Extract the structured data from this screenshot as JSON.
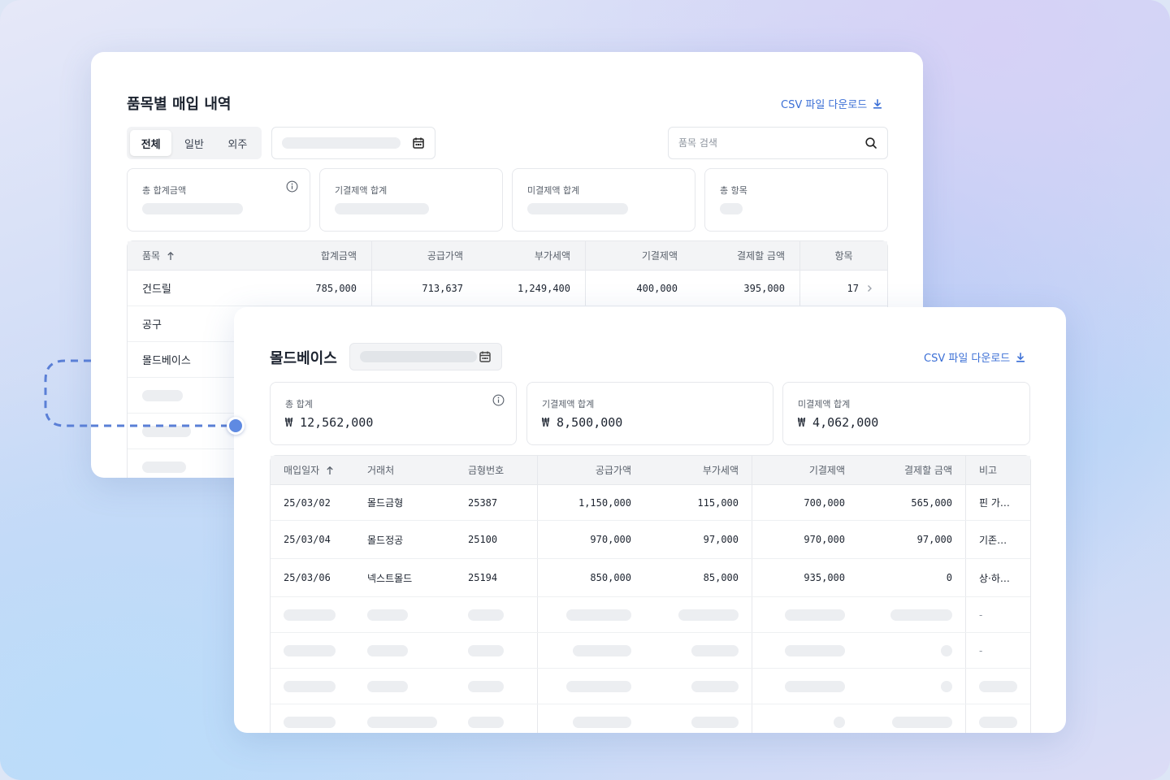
{
  "colors": {
    "accent": "#3b6fd6"
  },
  "cardA": {
    "title": "품목별 매입 내역",
    "csv_label": "CSV 파일 다운로드",
    "segments": [
      "전체",
      "일반",
      "외주"
    ],
    "active_segment": "전체",
    "search_placeholder": "품목 검색",
    "stats": [
      "총 합계금액",
      "기결제액 합계",
      "미결제액 합계",
      "총 항목"
    ],
    "columns": [
      "품목",
      "합계금액",
      "공급가액",
      "부가세액",
      "기결제액",
      "결제할 금액",
      "항목"
    ],
    "sort_icon": "arrow-up-icon",
    "rows": [
      {
        "item": "건드릴",
        "total": "785,000",
        "supply": "713,637",
        "vat": "1,249,400",
        "paid": "400,000",
        "due": "395,000",
        "count": "17"
      },
      {
        "item": "공구"
      },
      {
        "item": "몰드베이스"
      }
    ]
  },
  "cardB": {
    "title": "몰드베이스",
    "csv_label": "CSV 파일 다운로드",
    "stats": [
      {
        "label": "총 합계",
        "value": "₩ 12,562,000"
      },
      {
        "label": "기결제액 합계",
        "value": "₩ 8,500,000"
      },
      {
        "label": "미결제액 합계",
        "value": "₩ 4,062,000"
      }
    ],
    "columns": [
      "매입일자",
      "거래처",
      "금형번호",
      "공급가액",
      "부가세액",
      "기결제액",
      "결제할 금액",
      "비고"
    ],
    "rows": [
      {
        "date": "25/03/02",
        "vendor": "몰드금형",
        "mold": "25387",
        "supply": "1,150,000",
        "vat": "115,000",
        "paid": "700,000",
        "due": "565,000",
        "note": "핀 가…"
      },
      {
        "date": "25/03/04",
        "vendor": "몰드정공",
        "mold": "25100",
        "supply": "970,000",
        "vat": "97,000",
        "paid": "970,000",
        "due": "97,000",
        "note": "기존…"
      },
      {
        "date": "25/03/06",
        "vendor": "넥스트몰드",
        "mold": "25194",
        "supply": "850,000",
        "vat": "85,000",
        "paid": "935,000",
        "due": "0",
        "note": "상·하…"
      }
    ],
    "placeholder_notes": [
      "-",
      "-"
    ]
  }
}
